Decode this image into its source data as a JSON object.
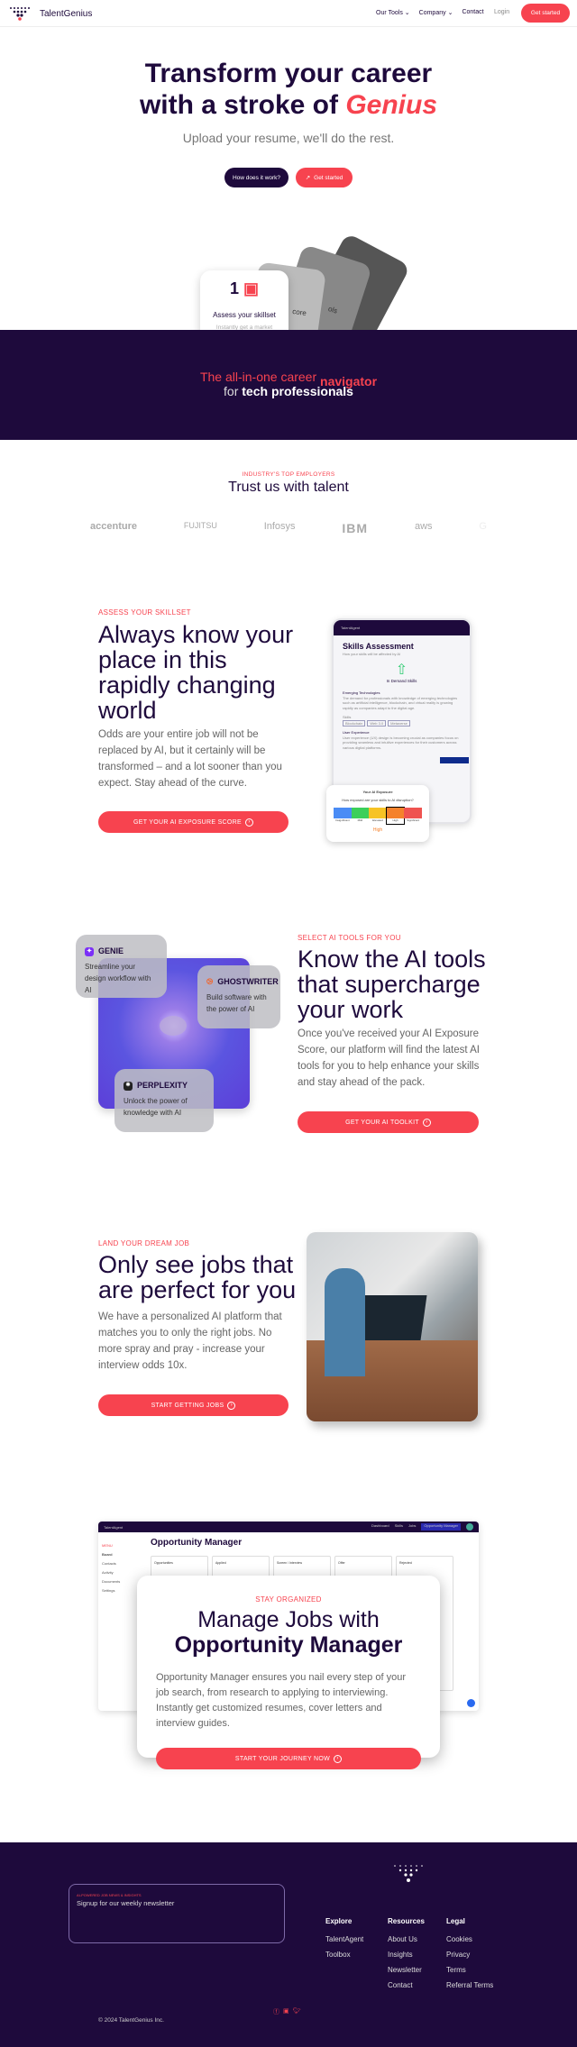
{
  "brand": {
    "name": "TalentGenius",
    "accent": "#f7434f",
    "navy": "#1e0a3c"
  },
  "nav": {
    "items": [
      "Our Tools",
      "Company",
      "Contact"
    ],
    "login": "Login",
    "cta": "Get started"
  },
  "hero": {
    "title_line1": "Transform your career",
    "title_line2": "with a stroke of ",
    "title_accent": "Genius",
    "subtitle": "Upload your resume, we'll do the rest.",
    "btn_how": "How does it work?",
    "btn_start": "Get started",
    "card": {
      "number": "1",
      "title": "Assess your skillset",
      "text": "Instantly get a market analysis of your skills and align your career path with industry demands"
    },
    "back_cards": [
      "core",
      "ols",
      "Job"
    ]
  },
  "band": {
    "line1": "The all-in-one career ",
    "line1_accent": "navigator",
    "line2_pre": "for ",
    "line2_bold": "tech professionals"
  },
  "trust": {
    "label": "INDUSTRY'S TOP EMPLOYERS",
    "title": "Trust us with talent",
    "logos": [
      "accenture",
      "FUJITSU",
      "Infosys",
      "IBM",
      "aws",
      "G"
    ]
  },
  "skills": {
    "label": "ASSESS YOUR SKILLSET",
    "title": "Always know your place in this rapidly changing world",
    "body": "Odds are your entire job will not be replaced by AI, but it certainly will be transformed – and a lot sooner than you expect. Stay ahead of the curve.",
    "cta": "GET YOUR AI EXPOSURE SCORE",
    "mock": {
      "app": "TalentAgent",
      "title": "Skills Assessment",
      "subtitle": "How your skills will be affected by AI",
      "demand": "In Demand Skills",
      "section1": "Emerging Technologies",
      "section1_text": "The demand for professionals with knowledge of emerging technologies such as artificial intelligence, blockchain, and virtual reality is growing rapidly as companies adapt to the digital age.",
      "skills_label": "Skills",
      "tags": [
        "Blockchain",
        "Web 3.0",
        "Metaverse"
      ],
      "section2": "User Experience",
      "section2_text": "User experience (UX) design is becoming crucial as companies focus on providing seamless and intuitive experiences for their customers across various digital platforms.",
      "exposure_title": "Your AI Exposure",
      "exposure_q": "How exposed are your skills to AI disruption?",
      "scale": [
        "Insignificant",
        "Mild",
        "Elevated",
        "High",
        "Significant"
      ],
      "scale_colors": [
        "#4a8cf5",
        "#3ccf5a",
        "#f7c325",
        "#f5822c",
        "#ef5350"
      ],
      "selected": "High"
    }
  },
  "tools": {
    "label": "SELECT AI TOOLS FOR YOU",
    "title": "Know the AI tools that supercharge your work",
    "body": "Once you've received your AI Exposure Score, our platform will find the latest AI tools for you to help enhance your skills and stay ahead of the pack.",
    "cta": "GET YOUR AI TOOLKIT",
    "cards": [
      {
        "name": "GENIE",
        "text": "Streamline your design workflow with AI"
      },
      {
        "name": "GHOSTWRITER",
        "text": "Build software with the power of AI"
      },
      {
        "name": "PERPLEXITY",
        "text": "Unlock the power of knowledge with AI"
      }
    ]
  },
  "jobs": {
    "label": "LAND YOUR DREAM JOB",
    "title": "Only see jobs that are perfect for you",
    "body": "We have a personalized AI platform that matches you to only the right jobs. No more spray and pray - increase your interview odds 10x.",
    "cta": "START GETTING JOBS"
  },
  "opp": {
    "mock": {
      "app": "TalentAgent",
      "nav": [
        "Dashboard",
        "Skills",
        "Jobs",
        "Opportunity Manager"
      ],
      "menu": "MENU",
      "side": [
        "Board",
        "Contacts",
        "Activity",
        "Documents",
        "Settings"
      ],
      "title": "Opportunity Manager",
      "cols": [
        "Opportunities",
        "Applied",
        "Screen / Interview",
        "Offer",
        "Rejected"
      ]
    },
    "label": "STAY ORGANIZED",
    "title1": "Manage Jobs with",
    "title2": "Opportunity Manager",
    "body": "Opportunity Manager ensures you nail every step of your job search, from research to applying to interviewing. Instantly get customized resumes, cover letters and interview guides.",
    "cta": "START YOUR JOURNEY NOW"
  },
  "footer": {
    "news_label": "AI-POWERED JOB NEWS & INSIGHTS",
    "news_title": "Signup for our weekly newsletter",
    "cols": [
      {
        "h": "Explore",
        "items": [
          "TalentAgent",
          "Toolbox"
        ]
      },
      {
        "h": "Resources",
        "items": [
          "About Us",
          "Insights",
          "Newsletter",
          "Contact"
        ]
      },
      {
        "h": "Legal",
        "items": [
          "Cookies",
          "Privacy",
          "Terms",
          "Referral Terms"
        ]
      }
    ],
    "copyright": "© 2024 TalentGenius Inc.",
    "social": [
      "facebook-icon",
      "linkedin-icon",
      "twitter-icon"
    ]
  }
}
